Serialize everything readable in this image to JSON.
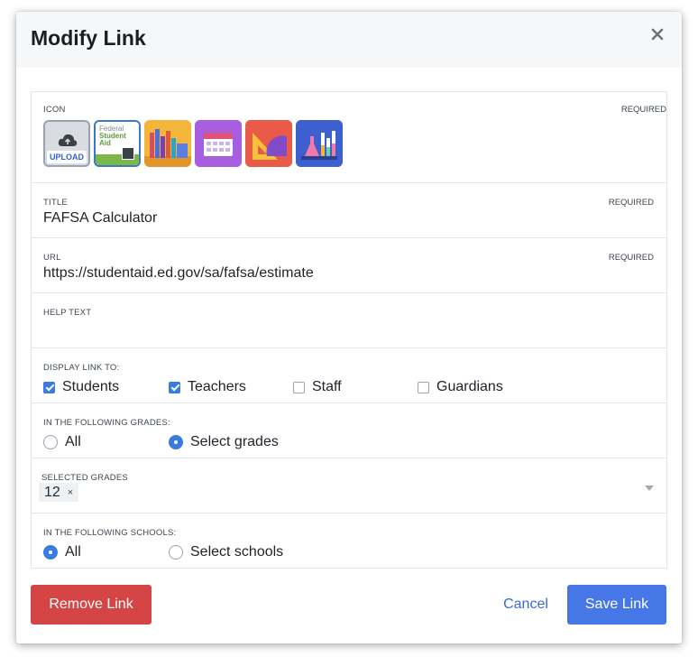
{
  "modal": {
    "title": "Modify Link"
  },
  "icon_field": {
    "label": "ICON",
    "required": "REQUIRED",
    "upload_label": "UPLOAD",
    "fsa_lines": [
      "Federal",
      "Student",
      "Aid"
    ],
    "icons": [
      "upload-icon",
      "federal-student-aid-icon",
      "books-icon",
      "calendar-icon",
      "geometry-icon",
      "lab-equipment-icon"
    ]
  },
  "title_field": {
    "label": "TITLE",
    "required": "REQUIRED",
    "value": "FAFSA Calculator"
  },
  "url_field": {
    "label": "URL",
    "required": "REQUIRED",
    "value": "https://studentaid.ed.gov/sa/fafsa/estimate"
  },
  "help_field": {
    "label": "HELP TEXT",
    "value": ""
  },
  "display_field": {
    "label": "DISPLAY LINK TO:",
    "options": [
      {
        "label": "Students",
        "checked": true
      },
      {
        "label": "Teachers",
        "checked": true
      },
      {
        "label": "Staff",
        "checked": false
      },
      {
        "label": "Guardians",
        "checked": false
      }
    ]
  },
  "grades_field": {
    "label": "IN THE FOLLOWING GRADES:",
    "options": [
      {
        "label": "All",
        "selected": false
      },
      {
        "label": "Select grades",
        "selected": true
      }
    ]
  },
  "selected_grades": {
    "label": "SELECTED GRADES",
    "chips": [
      "12"
    ],
    "remove": "×"
  },
  "schools_field": {
    "label": "IN THE FOLLOWING SCHOOLS:",
    "options": [
      {
        "label": "All",
        "selected": true
      },
      {
        "label": "Select schools",
        "selected": false
      }
    ]
  },
  "footer": {
    "remove": "Remove Link",
    "cancel": "Cancel",
    "save": "Save Link"
  },
  "colors": {
    "primary": "#4577e6",
    "danger": "#d64545",
    "link": "#3a69d6"
  }
}
